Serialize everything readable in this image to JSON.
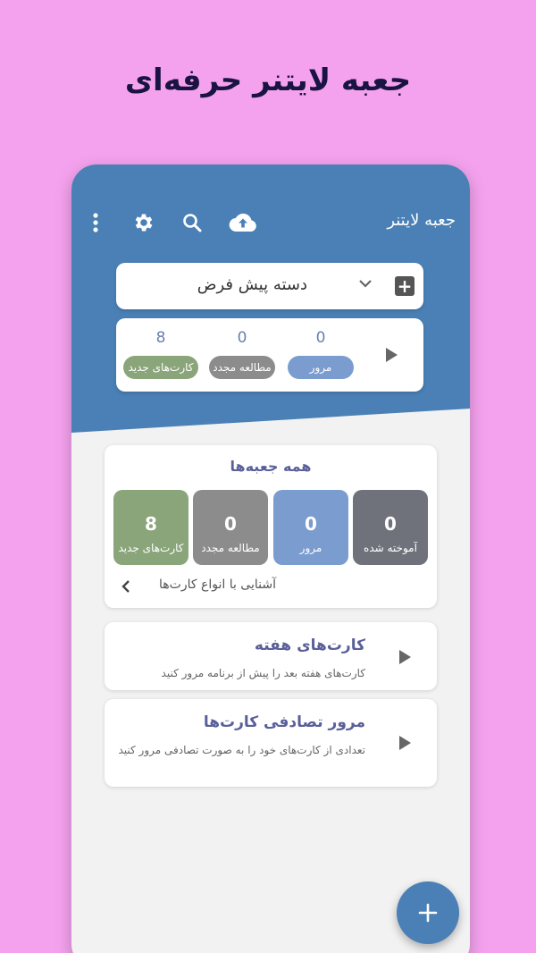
{
  "headline": "جعبه لایتنر حرفه‌ای",
  "colors": {
    "background": "#f5a2ee",
    "primary": "#4a80b5",
    "new_cards": "#8aa57a",
    "relearn": "#8c8c8c",
    "review": "#7b9ccf",
    "learned": "#6f727a"
  },
  "appbar": {
    "title": "جعبه لایتنر",
    "icons": [
      "more-vert-icon",
      "settings-gear-icon",
      "search-icon",
      "cloud-upload-icon"
    ]
  },
  "deck": {
    "name": "دسته پیش فرض",
    "dropdown_icon": "chevron-down-icon",
    "add_icon": "plus-square-icon"
  },
  "summary": {
    "play_icon": "play-icon",
    "review": {
      "count": "0",
      "label": "مرور"
    },
    "relearn": {
      "count": "0",
      "label": "مطالعه مجدد"
    },
    "new": {
      "count": "8",
      "label": "کارت‌های جدید"
    }
  },
  "all_boxes": {
    "title": "همه جعبه‌ها",
    "tiles": [
      {
        "count": "8",
        "label": "کارت‌های جدید"
      },
      {
        "count": "0",
        "label": "مطالعه مجدد"
      },
      {
        "count": "0",
        "label": "مرور"
      },
      {
        "count": "0",
        "label": "آموخته شده"
      }
    ],
    "intro_link": "آشنایی با انواع کارت‌ها"
  },
  "weekly": {
    "title": "کارت‌های هفته",
    "desc": "کارت‌های هفته بعد را پیش از برنامه مرور کنید"
  },
  "random_review": {
    "title": "مرور تصادفی کارت‌ها",
    "desc": "تعدادی از کارت‌های خود را به صورت تصادفی مرور کنید"
  },
  "fab": {
    "icon": "plus-icon"
  }
}
